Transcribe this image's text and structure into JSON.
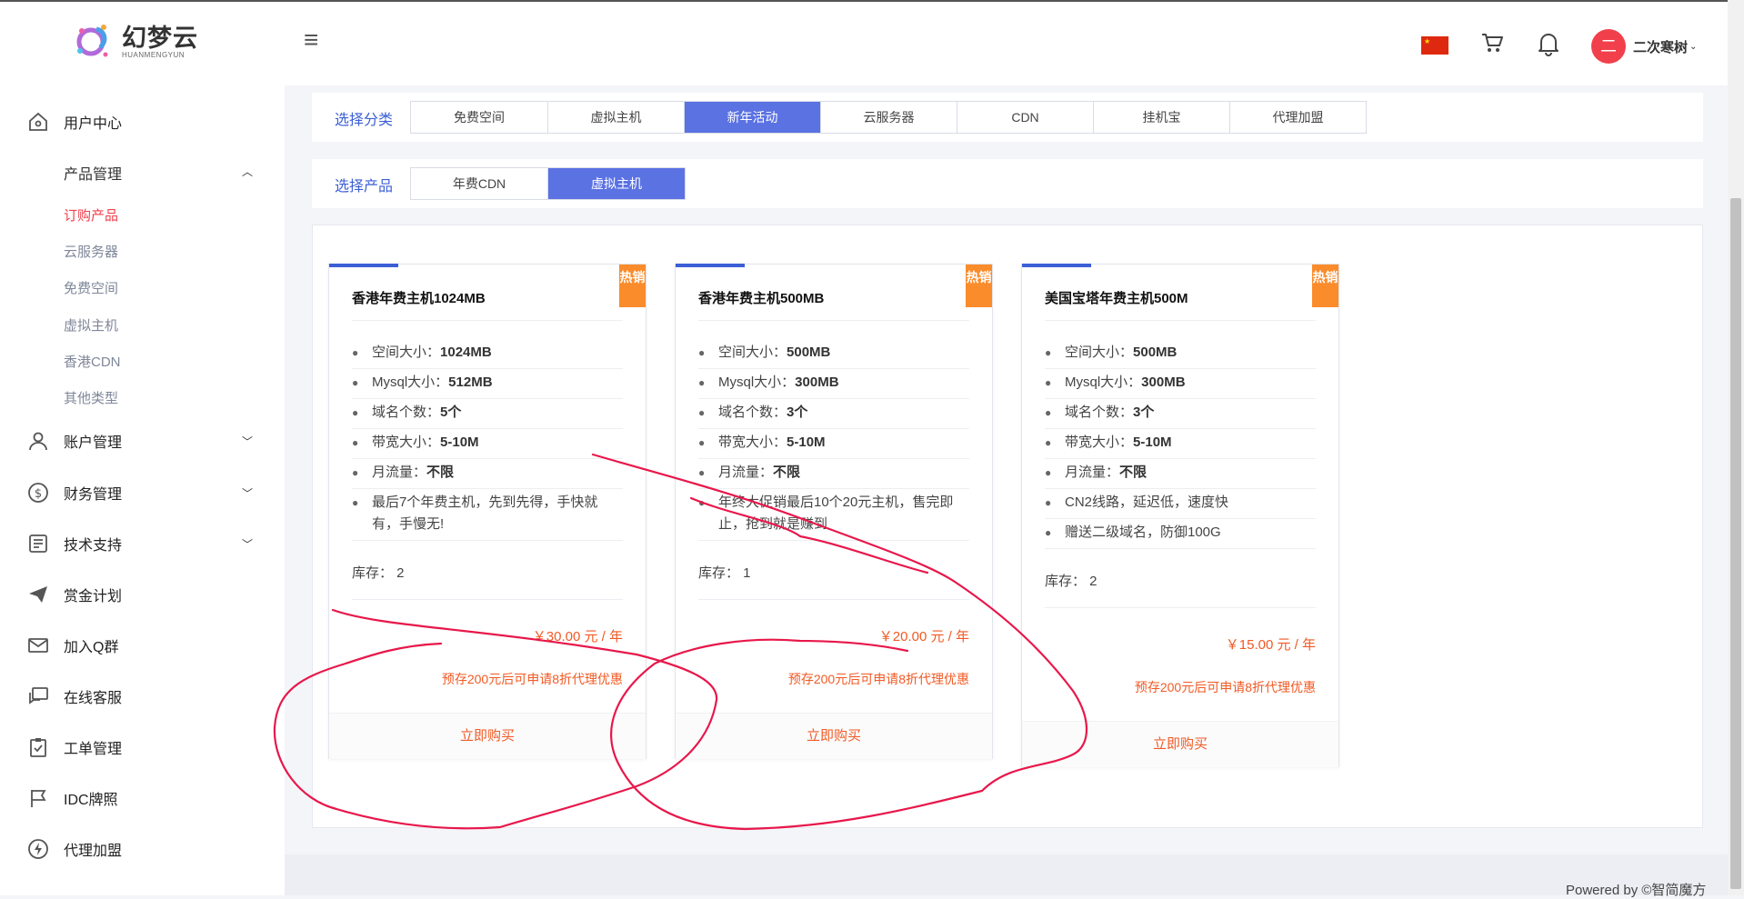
{
  "brand": {
    "name_cn": "幻梦云",
    "name_en": "HUANMENGYUN"
  },
  "header": {
    "username": "二次寒树",
    "avatar_char": "二"
  },
  "sidebar": {
    "items": [
      {
        "label": "用户中心"
      },
      {
        "label": "产品管理"
      },
      {
        "label": "账户管理"
      },
      {
        "label": "财务管理"
      },
      {
        "label": "技术支持"
      },
      {
        "label": "赏金计划"
      },
      {
        "label": "加入Q群"
      },
      {
        "label": "在线客服"
      },
      {
        "label": "工单管理"
      },
      {
        "label": "IDC牌照"
      },
      {
        "label": "代理加盟"
      }
    ],
    "product_sub": [
      {
        "label": "订购产品"
      },
      {
        "label": "云服务器"
      },
      {
        "label": "免费空间"
      },
      {
        "label": "虚拟主机"
      },
      {
        "label": "香港CDN"
      },
      {
        "label": "其他类型"
      }
    ]
  },
  "category_filter": {
    "label": "选择分类",
    "options": [
      "免费空间",
      "虚拟主机",
      "新年活动",
      "云服务器",
      "CDN",
      "挂机宝",
      "代理加盟"
    ],
    "selected": "新年活动"
  },
  "product_filter": {
    "label": "选择产品",
    "options": [
      "年费CDN",
      "虚拟主机"
    ],
    "selected": "虚拟主机"
  },
  "cards": [
    {
      "badge": "热销",
      "title": "香港年费主机1024MB",
      "specs": [
        {
          "k": "空间大小：",
          "v": "1024MB"
        },
        {
          "k": "Mysql大小：",
          "v": "512MB"
        },
        {
          "k": "域名个数：",
          "v": "5个"
        },
        {
          "k": "带宽大小：",
          "v": "5-10M"
        },
        {
          "k": "月流量：",
          "v": "不限"
        },
        {
          "k": "最后7个年费主机，先到先得，手快就有，手慢无!",
          "v": ""
        }
      ],
      "stock": "库存：  2",
      "price": "￥30.00 元 / 年",
      "promo": "预存200元后可申请8折代理优惠",
      "buy": "立即购买"
    },
    {
      "badge": "热销",
      "title": "香港年费主机500MB",
      "specs": [
        {
          "k": "空间大小：",
          "v": "500MB"
        },
        {
          "k": "Mysql大小：",
          "v": "300MB"
        },
        {
          "k": "域名个数：",
          "v": "3个"
        },
        {
          "k": "带宽大小：",
          "v": "5-10M"
        },
        {
          "k": "月流量：",
          "v": "不限"
        },
        {
          "k": "年终大促销最后10个20元主机，售完即止，抢到就是赚到",
          "v": ""
        }
      ],
      "stock": "库存：  1",
      "price": "￥20.00 元 / 年",
      "promo": "预存200元后可申请8折代理优惠",
      "buy": "立即购买"
    },
    {
      "badge": "热销",
      "title": "美国宝塔年费主机500M",
      "specs": [
        {
          "k": "空间大小：",
          "v": "500MB"
        },
        {
          "k": "Mysql大小：",
          "v": "300MB"
        },
        {
          "k": "域名个数：",
          "v": "3个"
        },
        {
          "k": "带宽大小：",
          "v": "5-10M"
        },
        {
          "k": "月流量：",
          "v": "不限"
        },
        {
          "k": "CN2线路，延迟低，速度快",
          "v": ""
        },
        {
          "k": "赠送二级域名，防御100G",
          "v": ""
        }
      ],
      "stock": "库存：  2",
      "price": "￥15.00 元 / 年",
      "promo": "预存200元后可申请8折代理优惠",
      "buy": "立即购买"
    }
  ],
  "footer": {
    "powered": "Powered by ©智简魔方"
  },
  "colors": {
    "accent": "#5b72e3",
    "danger": "#f1404b",
    "price": "#f15a24",
    "hot": "#fa8c2c",
    "annotation": "#e8174a"
  }
}
